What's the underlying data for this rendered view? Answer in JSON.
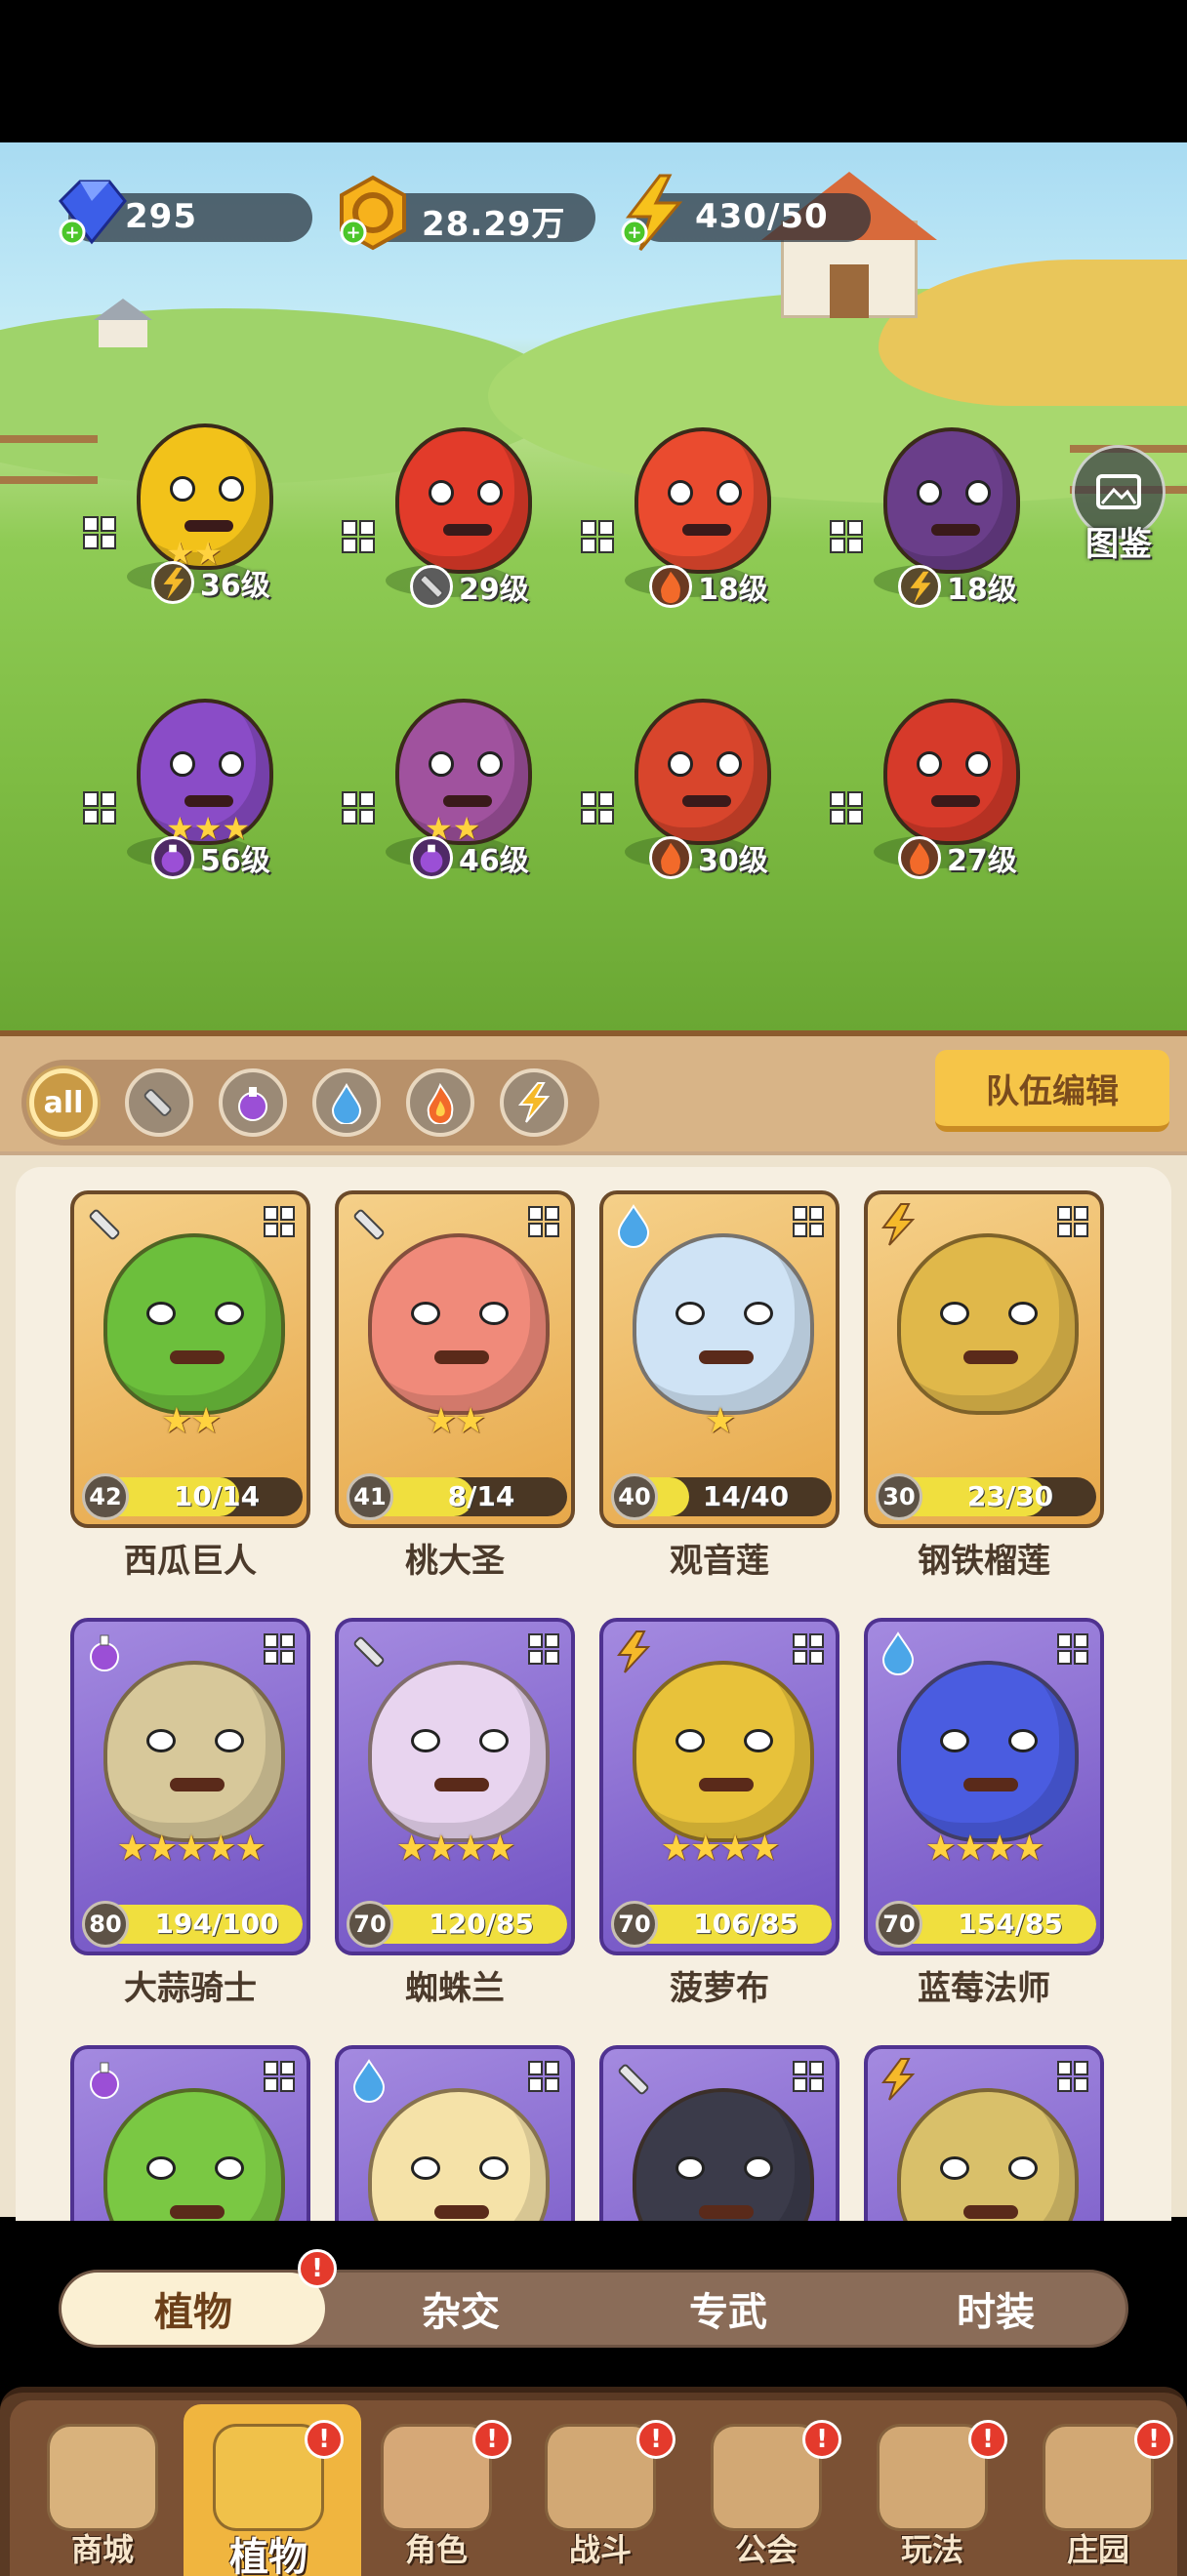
{
  "resources": [
    {
      "name": "diamond",
      "icon": "diamond-icon",
      "value": "295"
    },
    {
      "name": "coin",
      "icon": "coin-icon",
      "value": "28.29万"
    },
    {
      "name": "energy",
      "icon": "lightning-icon",
      "value": "430/50"
    }
  ],
  "atlas": {
    "label": "图鉴",
    "icon": "photo-icon"
  },
  "field_units": [
    {
      "element": "lightning",
      "level": "36级",
      "stars": 2,
      "color": "#f2c21a"
    },
    {
      "element": "sword",
      "level": "29级",
      "stars": 0,
      "color": "#e23b2a"
    },
    {
      "element": "fire",
      "level": "18级",
      "stars": 0,
      "color": "#ea4b2f"
    },
    {
      "element": "lightning",
      "level": "18级",
      "stars": 0,
      "color": "#6a3e8a"
    },
    {
      "element": "potion",
      "level": "56级",
      "stars": 3,
      "color": "#8a4cc7"
    },
    {
      "element": "potion",
      "level": "46级",
      "stars": 2,
      "color": "#a0529e"
    },
    {
      "element": "fire",
      "level": "30级",
      "stars": 0,
      "color": "#d8452c"
    },
    {
      "element": "fire",
      "level": "27级",
      "stars": 0,
      "color": "#d63a2a"
    }
  ],
  "filters": {
    "all_label": "all",
    "items": [
      "sword",
      "potion",
      "water",
      "fire",
      "lightning"
    ]
  },
  "team_edit_label": "队伍编辑",
  "cards": [
    {
      "name": "西瓜巨人",
      "level": "42",
      "count": "10/14",
      "progress": 0.71,
      "stars": "★★",
      "type": "sword",
      "frame": "gold"
    },
    {
      "name": "桃大圣",
      "level": "41",
      "count": "8/14",
      "progress": 0.57,
      "stars": "★★",
      "type": "sword",
      "frame": "gold"
    },
    {
      "name": "观音莲",
      "level": "40",
      "count": "14/40",
      "progress": 0.35,
      "stars": "★",
      "type": "water",
      "frame": "gold"
    },
    {
      "name": "钢铁榴莲",
      "level": "30",
      "count": "23/30",
      "progress": 0.77,
      "stars": "",
      "type": "lightning",
      "frame": "gold"
    },
    {
      "name": "大蒜骑士",
      "level": "80",
      "count": "194/100",
      "progress": 1,
      "stars": "★★★★★",
      "type": "potion",
      "frame": "purple"
    },
    {
      "name": "蜘蛛兰",
      "level": "70",
      "count": "120/85",
      "progress": 1,
      "stars": "★★★★",
      "type": "sword",
      "frame": "purple"
    },
    {
      "name": "菠萝布",
      "level": "70",
      "count": "106/85",
      "progress": 1,
      "stars": "★★★★",
      "type": "lightning",
      "frame": "purple"
    },
    {
      "name": "蓝莓法师",
      "level": "70",
      "count": "154/85",
      "progress": 1,
      "stars": "★★★★",
      "type": "water",
      "frame": "purple"
    },
    {
      "name": "",
      "type": "potion",
      "frame": "purple"
    },
    {
      "name": "",
      "type": "water",
      "frame": "purple"
    },
    {
      "name": "",
      "type": "sword",
      "frame": "purple"
    },
    {
      "name": "",
      "type": "lightning",
      "frame": "purple"
    }
  ],
  "subtabs": [
    {
      "label": "植物",
      "active": true,
      "badge": "!"
    },
    {
      "label": "杂交",
      "active": false
    },
    {
      "label": "专武",
      "active": false
    },
    {
      "label": "时装",
      "active": false
    }
  ],
  "nav": [
    {
      "label": "商城",
      "icon": "shop-icon",
      "badge": ""
    },
    {
      "label": "植物",
      "icon": "plant-icon",
      "badge": "!",
      "active": true
    },
    {
      "label": "角色",
      "icon": "character-icon",
      "badge": "!"
    },
    {
      "label": "战斗",
      "icon": "battle-icon",
      "badge": "!"
    },
    {
      "label": "公会",
      "icon": "guild-icon",
      "badge": "!"
    },
    {
      "label": "玩法",
      "icon": "gameplay-icon",
      "badge": "!"
    },
    {
      "label": "庄园",
      "icon": "manor-icon",
      "badge": "!"
    }
  ],
  "colors": {
    "sword": "#b9b9b9",
    "potion": "#9b4fd6",
    "water": "#4ba6e8",
    "fire": "#f26a2a",
    "lightning": "#f5b92a"
  }
}
